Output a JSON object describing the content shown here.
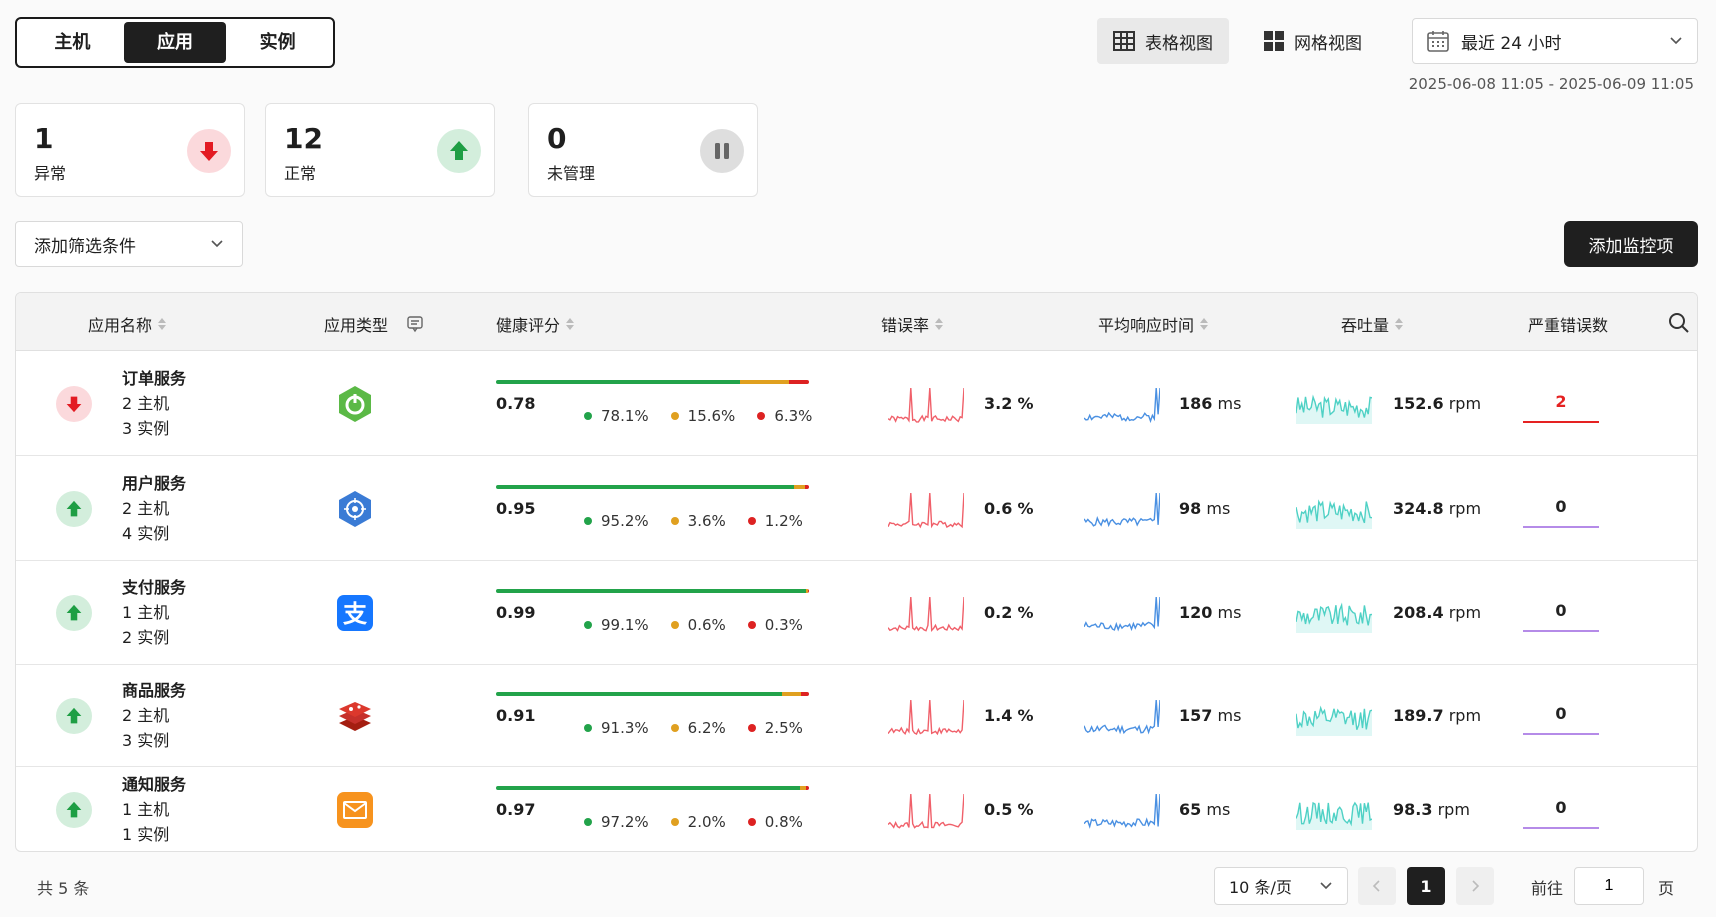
{
  "tabs": [
    "主机",
    "应用",
    "实例"
  ],
  "active_tab": "应用",
  "views": {
    "table": "表格视图",
    "grid": "网格视图"
  },
  "time_range": {
    "label": "最近 24 小时",
    "range": "2025-06-08 11:05 - 2025-06-09 11:05"
  },
  "summary": [
    {
      "count": "1",
      "label": "异常",
      "status": "down"
    },
    {
      "count": "12",
      "label": "正常",
      "status": "up"
    },
    {
      "count": "0",
      "label": "未管理",
      "status": "paused"
    }
  ],
  "filter": {
    "label": "添加筛选条件"
  },
  "add_button": "添加监控项",
  "columns": [
    "应用名称",
    "应用类型",
    "健康评分",
    "错误率",
    "平均响应时间",
    "吞吐量",
    "严重错误数"
  ],
  "rows": [
    {
      "status": "down",
      "name": "订单服务",
      "hosts": "2 主机",
      "instances": "3 实例",
      "type_icon": "spring-boot-icon",
      "score": "0.78",
      "green": 78.1,
      "orange": 15.6,
      "red": 6.3,
      "green_txt": "78.1%",
      "orange_txt": "15.6%",
      "red_txt": "6.3%",
      "error_rate": "3.2",
      "error_unit": "%",
      "resp": "186",
      "resp_unit": "ms",
      "thru": "152.6",
      "thru_unit": "rpm",
      "critical": "2"
    },
    {
      "status": "up",
      "name": "用户服务",
      "hosts": "2 主机",
      "instances": "4 实例",
      "type_icon": "kubernetes-icon",
      "score": "0.95",
      "green": 95.2,
      "orange": 3.6,
      "red": 1.2,
      "green_txt": "95.2%",
      "orange_txt": "3.6%",
      "red_txt": "1.2%",
      "error_rate": "0.6",
      "error_unit": "%",
      "resp": "98",
      "resp_unit": "ms",
      "thru": "324.8",
      "thru_unit": "rpm",
      "critical": "0"
    },
    {
      "status": "up",
      "name": "支付服务",
      "hosts": "1 主机",
      "instances": "2 实例",
      "type_icon": "alipay-icon",
      "score": "0.99",
      "green": 99.1,
      "orange": 0.6,
      "red": 0.3,
      "green_txt": "99.1%",
      "orange_txt": "0.6%",
      "red_txt": "0.3%",
      "error_rate": "0.2",
      "error_unit": "%",
      "resp": "120",
      "resp_unit": "ms",
      "thru": "208.4",
      "thru_unit": "rpm",
      "critical": "0"
    },
    {
      "status": "up",
      "name": "商品服务",
      "hosts": "2 主机",
      "instances": "3 实例",
      "type_icon": "redis-icon",
      "score": "0.91",
      "green": 91.3,
      "orange": 6.2,
      "red": 2.5,
      "green_txt": "91.3%",
      "orange_txt": "6.2%",
      "red_txt": "2.5%",
      "error_rate": "1.4",
      "error_unit": "%",
      "resp": "157",
      "resp_unit": "ms",
      "thru": "189.7",
      "thru_unit": "rpm",
      "critical": "0"
    },
    {
      "status": "up",
      "name": "通知服务",
      "hosts": "1 主机",
      "instances": "1 实例",
      "type_icon": "email-icon",
      "score": "0.97",
      "green": 97.2,
      "orange": 2.0,
      "red": 0.8,
      "green_txt": "97.2%",
      "orange_txt": "2.0%",
      "red_txt": "0.8%",
      "error_rate": "0.5",
      "error_unit": "%",
      "resp": "65",
      "resp_unit": "ms",
      "thru": "98.3",
      "thru_unit": "rpm",
      "critical": "0"
    }
  ],
  "pagination": {
    "total": "共 5 条",
    "page_size": "10 条/页",
    "current": "1",
    "goto": "前往",
    "goto_value": "1",
    "page_suffix": "页"
  },
  "colors": {
    "green": "#22a34a",
    "orange": "#e0a020",
    "red": "#dd2222",
    "error_line": "#f0606a",
    "resp_line": "#4a90e2",
    "thru_line": "#4fd1c5",
    "critical_red": "#e52222",
    "critical_purple": "#b58be8"
  }
}
